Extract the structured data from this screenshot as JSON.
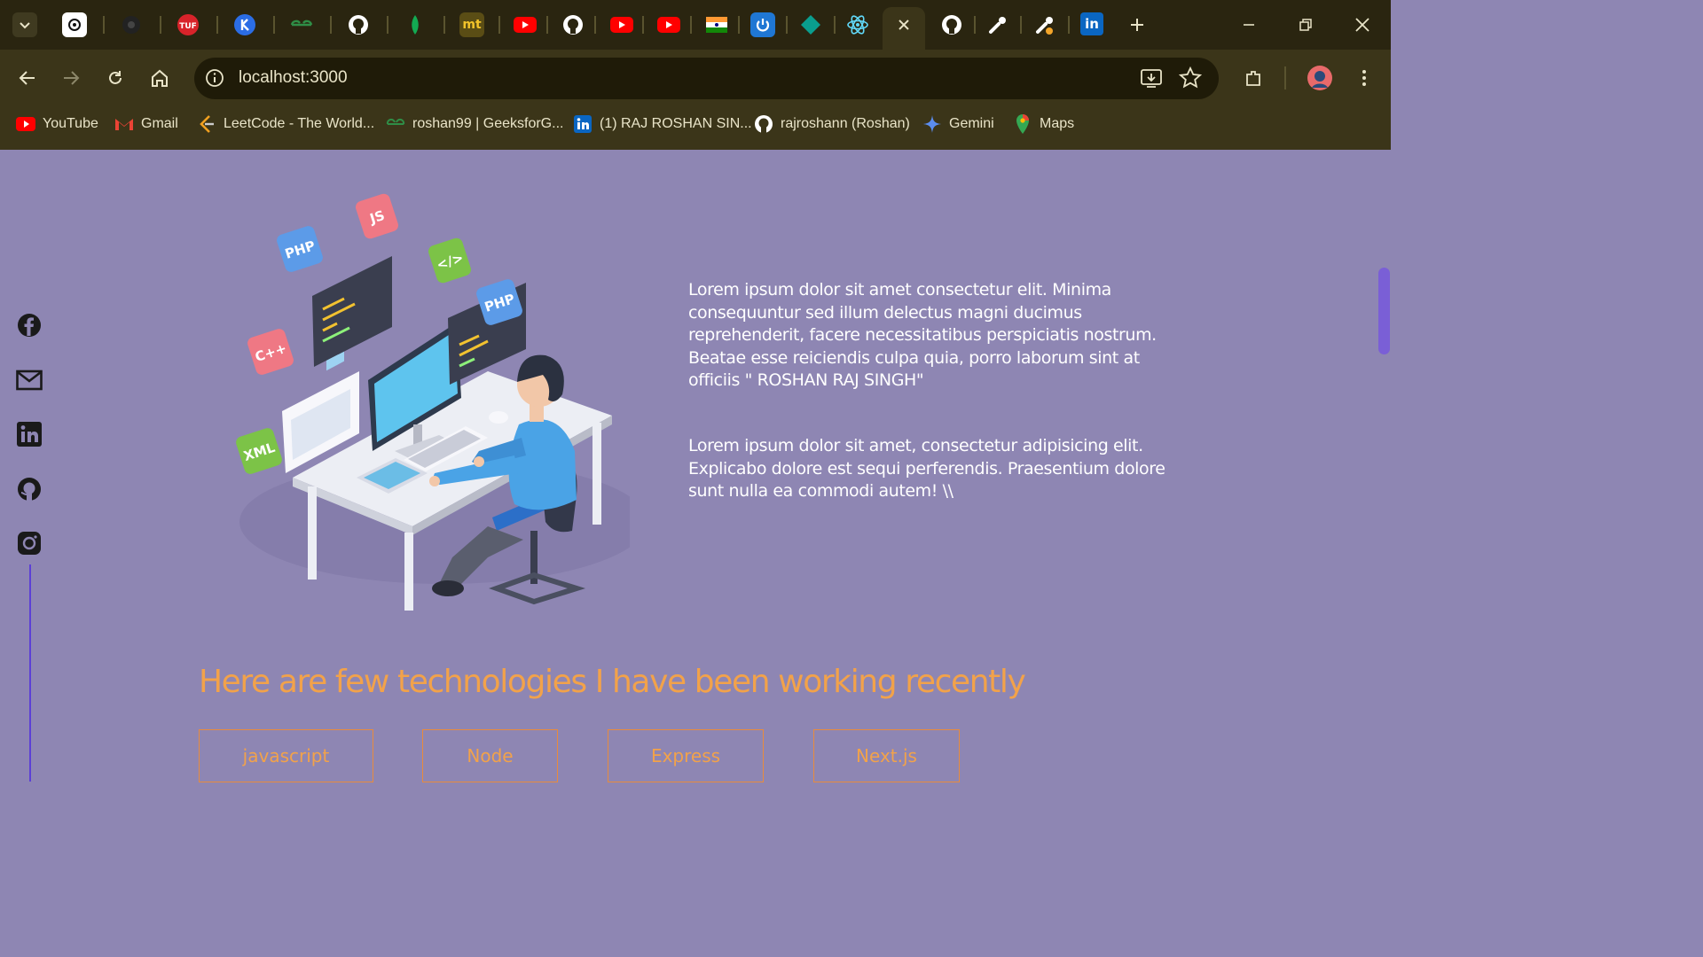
{
  "browser": {
    "tabs": [
      {
        "icon": "chatgpt-icon"
      },
      {
        "icon": "dark-circle-icon"
      },
      {
        "icon": "tuf-icon",
        "label": "TUF"
      },
      {
        "icon": "blue-k-icon"
      },
      {
        "icon": "geeksforgeeks-icon",
        "label": "GG"
      },
      {
        "icon": "github-icon"
      },
      {
        "icon": "mongodb-leaf-icon"
      },
      {
        "icon": "mt-icon",
        "label": "mt"
      },
      {
        "icon": "youtube-icon"
      },
      {
        "icon": "github-icon"
      },
      {
        "icon": "youtube-icon"
      },
      {
        "icon": "youtube-icon"
      },
      {
        "icon": "india-flag-icon"
      },
      {
        "icon": "power-icon"
      },
      {
        "icon": "teal-diamond-icon"
      },
      {
        "icon": "react-icon"
      },
      {
        "icon": "close-icon",
        "active": true
      },
      {
        "icon": "github-icon"
      },
      {
        "icon": "postman-icon"
      },
      {
        "icon": "postman-alt-icon"
      },
      {
        "icon": "linkedin-icon",
        "label": "in"
      }
    ],
    "new_tab_icon": "plus-icon",
    "tab_search_icon": "chevron-down-icon",
    "window_controls": [
      "minimize-icon",
      "restore-icon",
      "close-icon"
    ],
    "url": "localhost:3000",
    "site_info_icon": "info-icon",
    "bookmarks": [
      {
        "icon": "youtube-icon",
        "label": "YouTube"
      },
      {
        "icon": "gmail-icon",
        "label": "Gmail"
      },
      {
        "icon": "leetcode-icon",
        "label": "LeetCode - The World..."
      },
      {
        "icon": "geeksforgeeks-icon",
        "label": "roshan99 | GeeksforG..."
      },
      {
        "icon": "linkedin-icon",
        "label": "(1) RAJ ROSHAN SIN..."
      },
      {
        "icon": "github-icon",
        "label": "rajroshann (Roshan)"
      },
      {
        "icon": "gemini-icon",
        "label": "Gemini"
      },
      {
        "icon": "maps-icon",
        "label": "Maps"
      }
    ]
  },
  "social": [
    "facebook-icon",
    "mail-icon",
    "linkedin-icon",
    "github-icon",
    "instagram-icon"
  ],
  "hero": {
    "illustration_tags": [
      "PHP",
      "JS",
      "</>",
      "PHP",
      "C++",
      "XML"
    ]
  },
  "about": {
    "paragraph1": "Lorem ipsum dolor sit amet consectetur elit. Minima consequuntur sed illum delectus magni ducimus reprehenderit, facere necessitatibus perspiciatis nostrum. Beatae esse reiciendis culpa quia, porro laborum sint at officiis \" ROSHAN RAJ SINGH\"",
    "paragraph2": "Lorem ipsum dolor sit amet, consectetur adipisicing elit. Explicabo dolore est sequi perferendis. Praesentium dolore sunt nulla ea commodi autem! \\\\"
  },
  "technologies": {
    "heading": "Here are few technologies I have been working recently",
    "items": [
      "javascript",
      "Node",
      "Express",
      "Next.js"
    ]
  },
  "colors": {
    "page_background": "#8e86b3",
    "accent_orange": "#f2a24a",
    "social_line": "#5c3fd6"
  }
}
